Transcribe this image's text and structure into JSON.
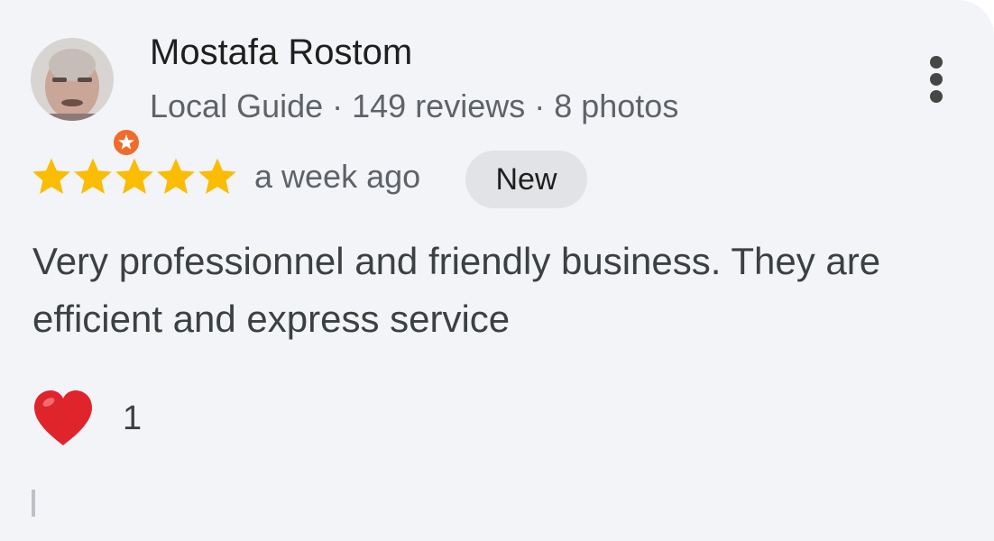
{
  "reviewer": {
    "name": "Mostafa Rostom",
    "badge_icon": "local-guide-star-icon",
    "meta": "Local Guide · 149 reviews · 8 photos"
  },
  "rating": {
    "stars": 5,
    "max": 5,
    "star_color": "#fbbc04",
    "time": "a week ago",
    "chip": "New"
  },
  "review": {
    "text": "Very professionnel and friendly business. They are efficient and express service"
  },
  "reaction": {
    "icon": "heart-icon",
    "count": "1"
  },
  "menu": {
    "icon": "more-vertical-icon"
  }
}
